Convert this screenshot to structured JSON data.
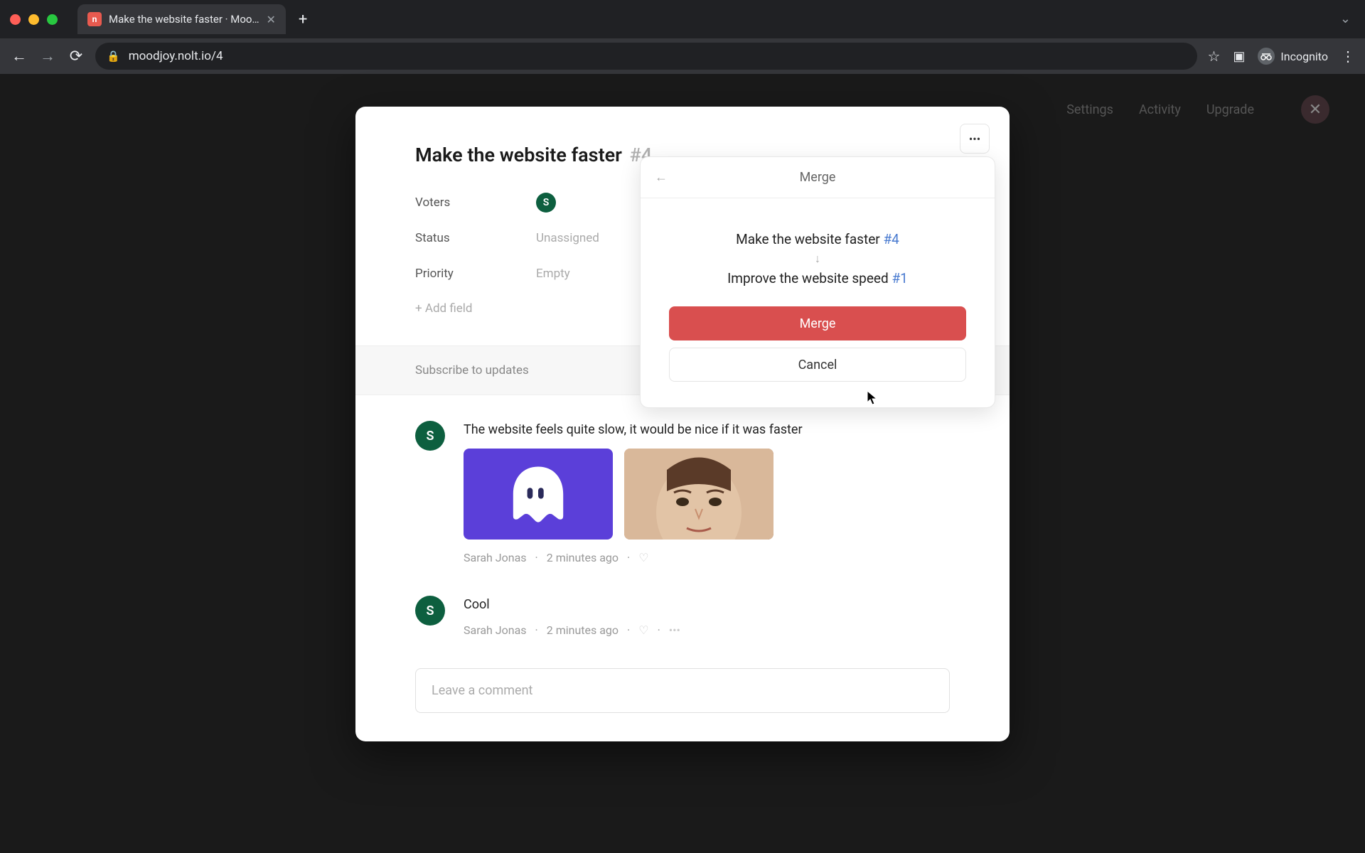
{
  "browser": {
    "tab_title": "Make the website faster · Moo…",
    "url": "moodjoy.nolt.io/4",
    "incognito_label": "Incognito"
  },
  "app_bg": {
    "nav": {
      "settings": "Settings",
      "activity": "Activity",
      "upgrade": "Upgrade"
    }
  },
  "card": {
    "title": "Make the website faster",
    "number": "#4",
    "meta": {
      "voters_label": "Voters",
      "voter_initial": "S",
      "status_label": "Status",
      "status_value": "Unassigned",
      "priority_label": "Priority",
      "priority_value": "Empty",
      "add_field": "+ Add field"
    },
    "subscribe": "Subscribe to updates"
  },
  "merge": {
    "header": "Merge",
    "source_title": "Make the website faster",
    "source_ref": "#4",
    "target_title": "Improve the website speed",
    "target_ref": "#1",
    "merge_btn": "Merge",
    "cancel_btn": "Cancel"
  },
  "comments": [
    {
      "avatar": "S",
      "text": "The website feels quite slow, it would be nice if it was faster",
      "author": "Sarah Jonas",
      "time": "2 minutes ago",
      "has_attachments": true
    },
    {
      "avatar": "S",
      "text": "Cool",
      "author": "Sarah Jonas",
      "time": "2 minutes ago",
      "has_attachments": false
    }
  ],
  "comment_input_placeholder": "Leave a comment"
}
